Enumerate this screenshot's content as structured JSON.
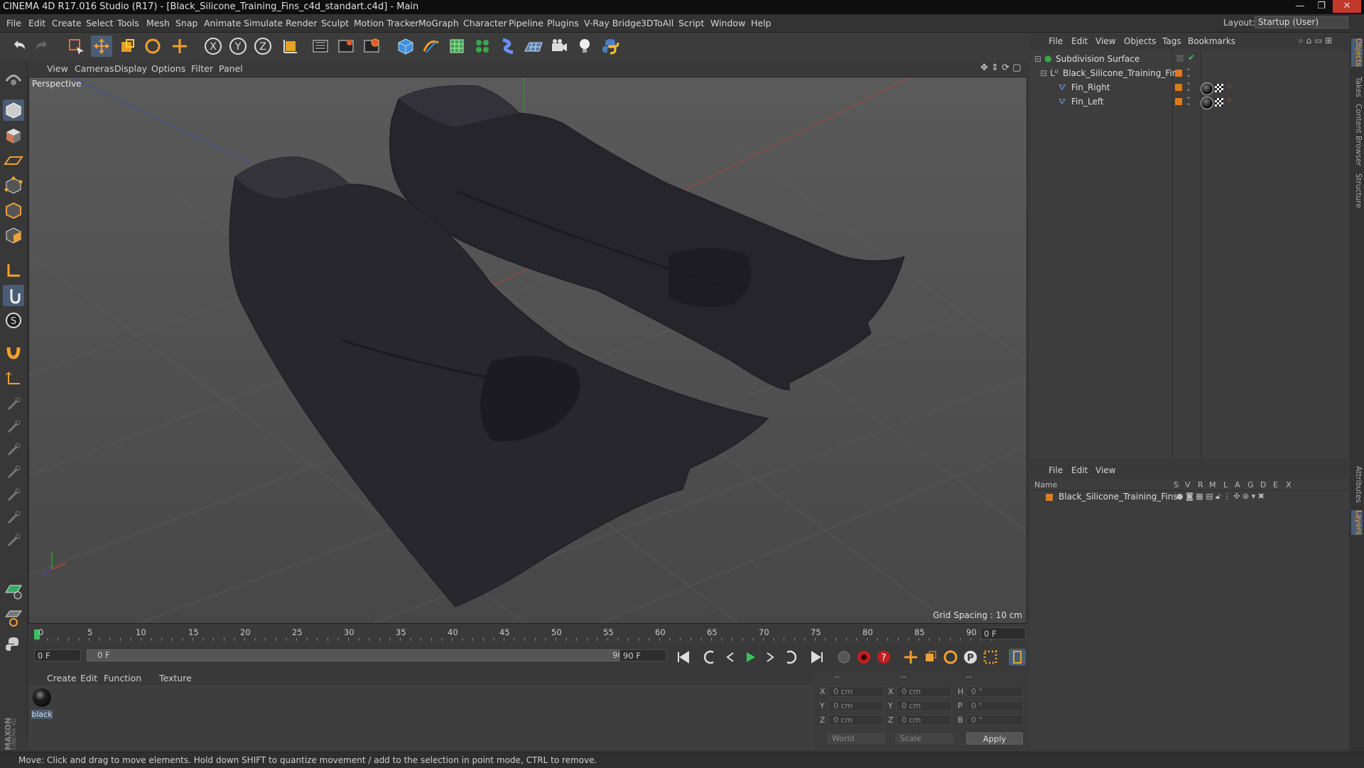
{
  "window": {
    "title": "CINEMA 4D R17.016 Studio (R17) - [Black_Silicone_Training_Fins_c4d_standart.c4d] - Main",
    "controls": [
      "—",
      "❐",
      "✕"
    ]
  },
  "menubar": {
    "items": [
      "File",
      "Edit",
      "Create",
      "Select",
      "Tools",
      "Mesh",
      "Snap",
      "Animate",
      "Simulate",
      "Render",
      "Sculpt",
      "Motion Tracker",
      "MoGraph",
      "Character",
      "Pipeline",
      "Plugins",
      "V-Ray Bridge",
      "3DToAll",
      "Script",
      "Window",
      "Help"
    ],
    "layout_label": "Layout:",
    "layout_value": "Startup (User)"
  },
  "toolbar": {
    "icons": [
      "undo-icon",
      "redo-icon",
      "select-icon",
      "move-icon",
      "scale-icon",
      "rotate-icon",
      "last-tool-icon",
      "x-axis-icon",
      "y-axis-icon",
      "z-axis-icon",
      "coordinate-system-icon",
      "render-view-icon",
      "render-picture-viewer-icon",
      "edit-render-settings-icon",
      "cube-icon",
      "pen-icon",
      "subdivision-icon",
      "cloner-icon",
      "deformer-icon",
      "floor-icon",
      "camera-icon",
      "light-icon",
      "python-icon"
    ],
    "axis_labels": [
      "X",
      "Y",
      "Z"
    ]
  },
  "viewport": {
    "menu": [
      "View",
      "Cameras",
      "Display",
      "Options",
      "Filter",
      "Panel"
    ],
    "label": "Perspective",
    "grid_spacing": "Grid Spacing : 10 cm"
  },
  "timeline": {
    "ticks": [
      "0",
      "5",
      "10",
      "15",
      "20",
      "25",
      "30",
      "35",
      "40",
      "45",
      "50",
      "55",
      "60",
      "65",
      "70",
      "75",
      "80",
      "85",
      "90"
    ],
    "current_frame": "0 F",
    "start_field": "0 F",
    "range_start": "0 F",
    "range_end": "90 F",
    "end_field": "90 F"
  },
  "materials": {
    "menu": [
      "Create",
      "Edit",
      "Function",
      "Texture"
    ],
    "items": [
      {
        "name": "black"
      }
    ]
  },
  "coords": {
    "headers": [
      "--",
      "--",
      "--"
    ],
    "rows": [
      {
        "l1": "X",
        "v1": "0 cm",
        "l2": "X",
        "v2": "0 cm",
        "l3": "H",
        "v3": "0 °"
      },
      {
        "l1": "Y",
        "v1": "0 cm",
        "l2": "Y",
        "v2": "0 cm",
        "l3": "P",
        "v3": "0 °"
      },
      {
        "l1": "Z",
        "v1": "0 cm",
        "l2": "Z",
        "v2": "0 cm",
        "l3": "B",
        "v3": "0 °"
      }
    ],
    "mode1": "World",
    "mode2": "Scale",
    "apply": "Apply"
  },
  "objects": {
    "menu": [
      "File",
      "Edit",
      "View",
      "Objects",
      "Tags",
      "Bookmarks"
    ],
    "tree": [
      {
        "name": "Subdivision Surface",
        "indent": 0
      },
      {
        "name": "Black_Silicone_Training_Fins",
        "indent": 1
      },
      {
        "name": "Fin_Right",
        "indent": 2
      },
      {
        "name": "Fin_Left",
        "indent": 2
      }
    ]
  },
  "layers": {
    "menu": [
      "File",
      "Edit",
      "View"
    ],
    "columns": [
      "Name",
      "S",
      "V",
      "R",
      "M",
      "L",
      "A",
      "G",
      "D",
      "E",
      "X"
    ],
    "rows": [
      {
        "name": "Black_Silicone_Training_Fins"
      }
    ]
  },
  "sidetabs": [
    "Objects",
    "Takes",
    "Content Browser",
    "Structure",
    "Attributes",
    "Layers"
  ],
  "status": "Move: Click and drag to move elements. Hold down SHIFT to quantize movement / add to the selection in point mode, CTRL to remove.",
  "colors": {
    "accent_orange": "#e07a1f",
    "active_blue": "#5a8fd6",
    "fin_color": "#24232a"
  }
}
